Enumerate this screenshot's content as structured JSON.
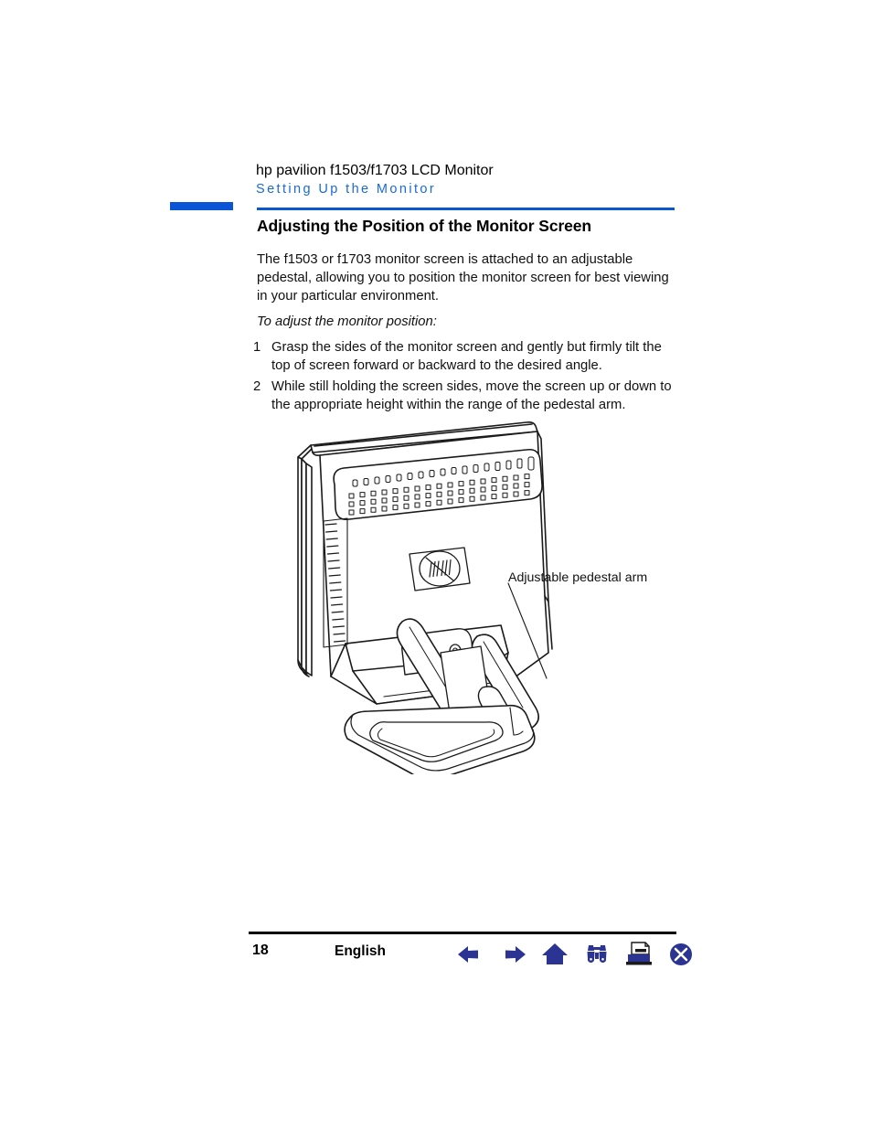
{
  "page": {
    "doc_title": "hp pavilion f1503/f1703 LCD Monitor",
    "doc_subtitle": "Setting Up the Monitor",
    "section_heading": "Adjusting the Position of the Monitor Screen",
    "intro_paragraph": "The f1503 or f1703 monitor screen is attached to an adjustable pedestal, allowing you to position the monitor screen for best viewing in your particular environment.",
    "lead_in": "To adjust the monitor position:",
    "steps": [
      {
        "number": "1",
        "text": "Grasp the sides of the monitor screen and gently but firmly tilt the top of screen forward or backward to the desired angle."
      },
      {
        "number": "2",
        "text": "While still holding the screen sides, move the screen up or down to the appropriate height within the range of the pedestal arm."
      }
    ],
    "illustration": {
      "alt_name": "lcd-monitor-with-adjustable-pedestal",
      "callout_label": "Adjustable pedestal arm",
      "logo_text": "hp"
    },
    "colors": {
      "header_blue": "#1a6ad8",
      "rule_blue": "#0b57d0",
      "accent_bar_blue": "#0a54d6",
      "footer_rule": "#000000",
      "nav_icon_blue": "#2b3492",
      "line_art": "#1a1a1a"
    }
  },
  "footer": {
    "page_number": "18",
    "language": "English",
    "nav_icons": [
      {
        "name": "previous-page-icon",
        "glyph": "left-arrow"
      },
      {
        "name": "next-page-icon",
        "glyph": "right-arrow"
      },
      {
        "name": "home-icon",
        "glyph": "house"
      },
      {
        "name": "search-icon",
        "glyph": "binoculars"
      },
      {
        "name": "print-icon",
        "glyph": "printer"
      },
      {
        "name": "close-icon",
        "glyph": "x-circle"
      }
    ]
  }
}
